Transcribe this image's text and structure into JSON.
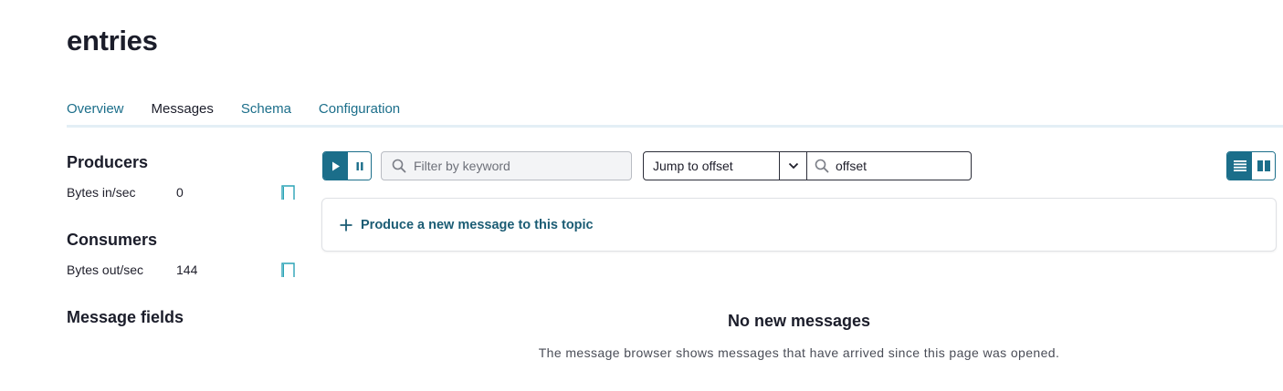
{
  "page": {
    "title": "entries"
  },
  "tabs": [
    {
      "label": "Overview"
    },
    {
      "label": "Messages"
    },
    {
      "label": "Schema"
    },
    {
      "label": "Configuration"
    }
  ],
  "sidebar": {
    "producers": {
      "heading": "Producers",
      "metric_label": "Bytes in/sec",
      "metric_value": "0"
    },
    "consumers": {
      "heading": "Consumers",
      "metric_label": "Bytes out/sec",
      "metric_value": "144"
    },
    "message_fields": {
      "heading": "Message fields"
    }
  },
  "toolbar": {
    "filter_placeholder": "Filter by keyword",
    "jump_select_value": "Jump to offset",
    "offset_placeholder": "offset"
  },
  "produce": {
    "label": "Produce a new message to this topic"
  },
  "empty_state": {
    "title": "No new messages",
    "description": "The message browser shows messages that have arrived since this page was opened."
  },
  "colors": {
    "accent": "#1b6e8a",
    "sparkline": "#2aa3b6"
  }
}
